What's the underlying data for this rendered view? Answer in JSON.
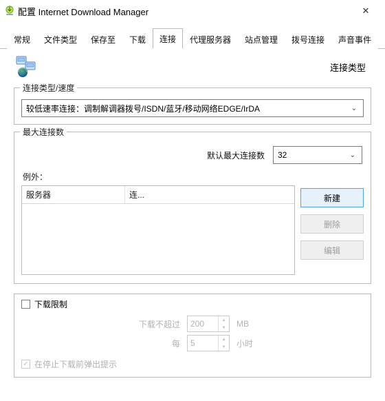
{
  "window": {
    "title": "配置 Internet Download Manager"
  },
  "tabs": [
    {
      "label": "常规"
    },
    {
      "label": "文件类型"
    },
    {
      "label": "保存至"
    },
    {
      "label": "下载"
    },
    {
      "label": "连接",
      "active": true
    },
    {
      "label": "代理服务器"
    },
    {
      "label": "站点管理"
    },
    {
      "label": "拨号连接"
    },
    {
      "label": "声音事件"
    }
  ],
  "section_heading": "连接类型",
  "group_conn_type": {
    "legend": "连接类型/速度",
    "value": "较低速率连接：调制解调器拨号/ISDN/蓝牙/移动网络EDGE/IrDA"
  },
  "group_max_conn": {
    "legend": "最大连接数",
    "label_default": "默认最大连接数",
    "value": "32",
    "exceptions_label": "例外：",
    "table_headers": {
      "server": "服务器",
      "conn": "连..."
    },
    "buttons": {
      "new": "新建",
      "delete": "删除",
      "edit": "编辑"
    }
  },
  "group_limit": {
    "checkbox_label": "下载限制",
    "row1": {
      "label": "下载不超过",
      "value": "200",
      "unit": "MB"
    },
    "row2": {
      "label": "每",
      "value": "5",
      "unit": "小时"
    },
    "checkbox2_label": "在停止下载前弹出提示"
  }
}
